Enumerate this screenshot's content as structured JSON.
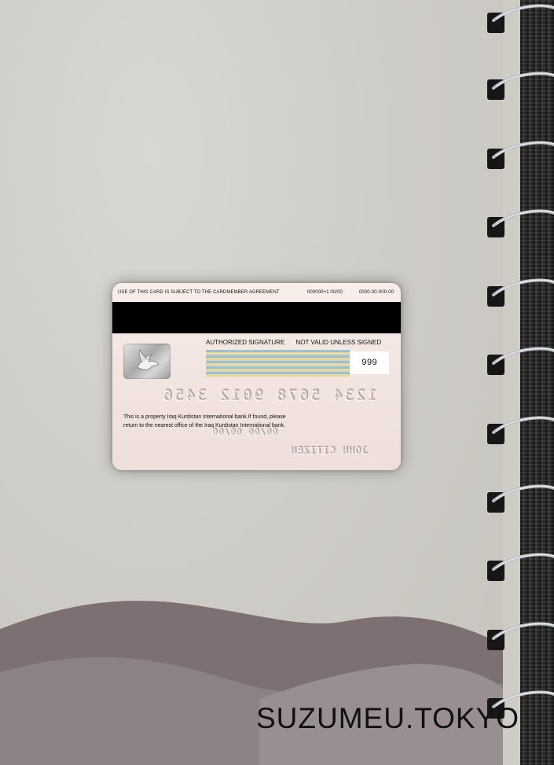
{
  "card": {
    "top_notice": "USE OF THIS CARD IS SUBJECT TO THE CARDMEMBER AGREEMENT",
    "phone_1": "000000+1 00/00",
    "phone_2": "0000-00-000-00",
    "authorized_signature": "AUTHORIZED SIGNATURE",
    "not_valid": "NOT VALID UNLESS SIGNED",
    "cvv": "999",
    "number_mirrored": "1234 5678 9012 3456",
    "property_line_1": "This is a property Iraq Kurdistan International bank.If found, please",
    "property_line_2": "return to the nearest office of the Iraq Kurdistan International bank.",
    "expiry_mirrored": "00/00 00/00",
    "holder_mirrored": "JOHN CITIZEN"
  },
  "watermark": "SUZUMEU.TOKYO",
  "colors": {
    "paper": "#cfccc6",
    "card_bg": "#f5e8e3",
    "stripe": "#000000",
    "hills": "#7c6f70"
  },
  "icons": [
    "dove-hologram-icon"
  ]
}
